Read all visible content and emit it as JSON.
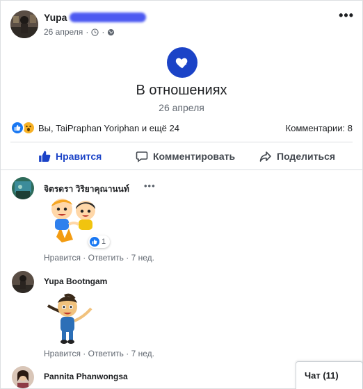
{
  "post": {
    "author_name": "Yupa",
    "date": "26 апреля",
    "meta_sep": "·",
    "more_icon": "more-horizontal-icon",
    "visibility_icon": "globe-icon"
  },
  "life_event": {
    "icon": "heart-icon",
    "accent": "#1b43c7",
    "title": "В отношениях",
    "date": "26 апреля"
  },
  "summary": {
    "reactions": [
      "like",
      "wow"
    ],
    "text": "Вы, TaiPraphan Yoriphan и ещё 24",
    "comments_label": "Комментарии: 8"
  },
  "actions": {
    "like": "Нравится",
    "comment": "Комментировать",
    "share": "Поделиться",
    "like_color": "#1b43c7"
  },
  "comments": [
    {
      "name": "จิตรดรา วิริยาคุณานนท์",
      "sticker": "cartoon-kids-sticker",
      "reaction_count": "1",
      "like": "Нравится",
      "reply": "Ответить",
      "time": "7 нед."
    },
    {
      "name": "Yupa Bootngam",
      "sticker": "minion-girl-sticker",
      "like": "Нравится",
      "reply": "Ответить",
      "time": "7 нед."
    },
    {
      "name": "Pannita Phanwongsa"
    }
  ],
  "chat": {
    "label": "Чат (11)"
  }
}
